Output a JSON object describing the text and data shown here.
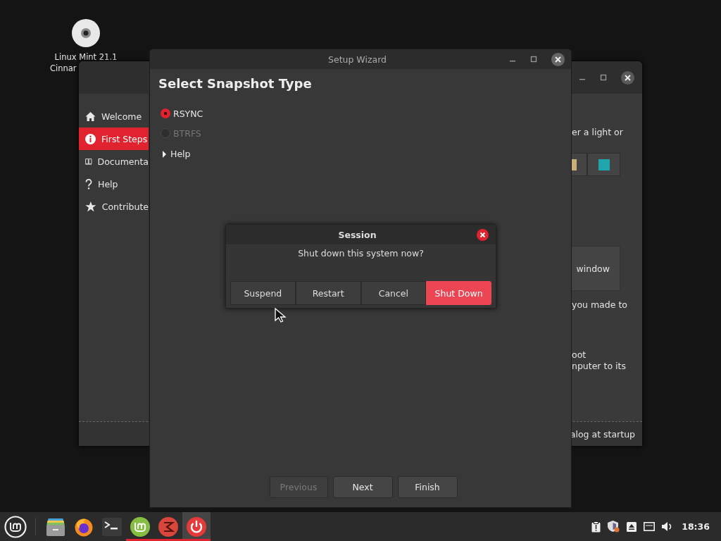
{
  "desktop_icons": [
    {
      "label": [
        "Linux Mint 21.1",
        "Cinnar"
      ]
    }
  ],
  "welcome_window": {
    "sidebar": [
      {
        "label": "Welcome",
        "kind": "home",
        "selected": false
      },
      {
        "label": "First Steps",
        "kind": "info",
        "selected": true
      },
      {
        "label": "Documenta",
        "kind": "book",
        "selected": false
      },
      {
        "label": "Help",
        "kind": "question",
        "selected": false
      },
      {
        "label": "Contribute",
        "kind": "star",
        "selected": false
      }
    ],
    "theme_text": "er a light or",
    "color_swatches": [
      {
        "color": "#c9b07a"
      },
      {
        "color": "#20a6aa"
      }
    ],
    "window_button": "window",
    "text_1": "you made to",
    "text_2": [
      "oot",
      "nputer to its"
    ],
    "footer_text": "alog at startup"
  },
  "setup_wizard": {
    "title": "Setup Wizard",
    "heading": "Select Snapshot Type",
    "options": [
      {
        "label": "RSYNC",
        "selected": true,
        "disabled": false
      },
      {
        "label": "BTRFS",
        "selected": false,
        "disabled": true
      }
    ],
    "expander": {
      "label": "Help",
      "expanded": false
    },
    "buttons": [
      {
        "label": "Previous",
        "disabled": true
      },
      {
        "label": "Next",
        "disabled": false
      },
      {
        "label": "Finish",
        "disabled": false
      }
    ]
  },
  "session_dialog": {
    "title": "Session",
    "message": "Shut down this system now?",
    "buttons": [
      {
        "label": "Suspend",
        "kind": "normal"
      },
      {
        "label": "Restart",
        "kind": "normal"
      },
      {
        "label": "Cancel",
        "kind": "normal"
      },
      {
        "label": "Shut Down",
        "kind": "destructive"
      }
    ]
  },
  "panel": {
    "launchers": [
      {
        "kind": "files",
        "running": false,
        "active": false
      },
      {
        "kind": "browser",
        "running": false,
        "active": false
      },
      {
        "kind": "terminal",
        "running": false,
        "active": false
      },
      {
        "kind": "mint",
        "running": true,
        "active": false
      },
      {
        "kind": "timeshift",
        "running": true,
        "active": false
      },
      {
        "kind": "power",
        "running": true,
        "active": true
      }
    ],
    "tray": [
      {
        "kind": "clipboard"
      },
      {
        "kind": "shield"
      },
      {
        "kind": "eject"
      },
      {
        "kind": "network"
      },
      {
        "kind": "volume"
      }
    ],
    "clock": "18:36"
  }
}
